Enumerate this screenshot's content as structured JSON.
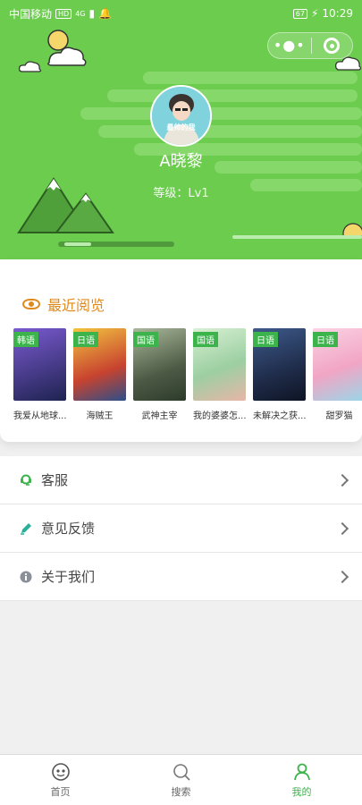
{
  "status_bar": {
    "carrier": "中国移动",
    "hd": "HD",
    "signal": "4G",
    "battery": "67",
    "time": "10:29"
  },
  "profile": {
    "avatar_caption": "最帅的我",
    "username": "A晓黎",
    "level": "等级：Lv1"
  },
  "recent": {
    "title": "最近阅览",
    "items": [
      {
        "tag": "韩语",
        "title": "我爱从地球...",
        "poster_color": "#3b2d6b"
      },
      {
        "tag": "日语",
        "title": "海贼王",
        "poster_color": "#c8432f"
      },
      {
        "tag": "国语",
        "title": "武神主宰",
        "poster_color": "#5a6b52"
      },
      {
        "tag": "国语",
        "title": "我的婆婆怎...",
        "poster_color": "#9ccfa2"
      },
      {
        "tag": "日语",
        "title": "未解决之获...",
        "poster_color": "#1f2c4a"
      },
      {
        "tag": "日语",
        "title": "甜罗猫",
        "poster_color": "#f1a5c4"
      }
    ]
  },
  "menu": {
    "items": [
      {
        "label": "客服",
        "icon": "customer-service-icon"
      },
      {
        "label": "意见反馈",
        "icon": "feedback-pen-icon"
      },
      {
        "label": "关于我们",
        "icon": "info-icon"
      }
    ]
  },
  "nav": {
    "home": "首页",
    "search": "搜索",
    "mine": "我的"
  },
  "colors": {
    "header_green": "#6ccc4e",
    "accent_orange": "#e08a1d",
    "active_green": "#3cb44b"
  }
}
